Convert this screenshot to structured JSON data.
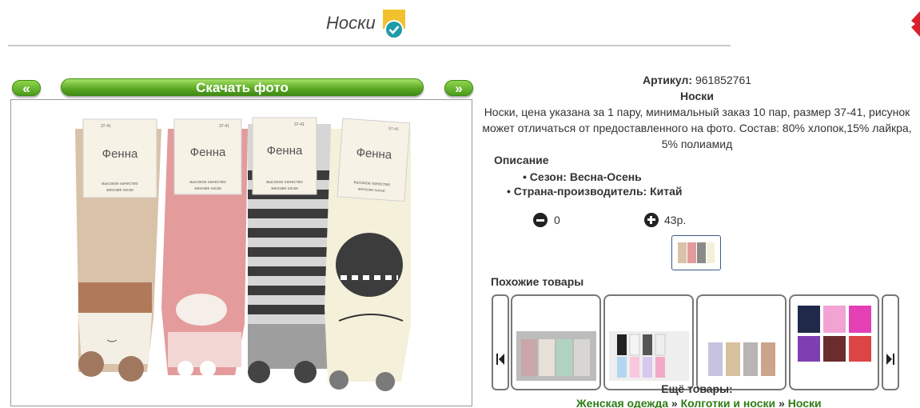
{
  "header": {
    "title": "Носки"
  },
  "gallery": {
    "prev_label": "«",
    "next_label": "»",
    "download_label": "Скачать фото",
    "sock_brand": "Фенна",
    "sock_size": "37-41",
    "sock_caption": "высокое качество",
    "sock_subcaption": "женские носки"
  },
  "product": {
    "article_label": "Артикул:",
    "article_value": "961852761",
    "name": "Носки",
    "description": "Носки, цена указана за 1 пару, минимальный заказ 10 пар, размер 37-41, рисунок может отличаться от предоставленного на фото. Состав: 80% хлопок,15% лайкра, 5% полиамид",
    "description_heading": "Описание",
    "properties": [
      "Сезон: Весна-Осень",
      "Страна-производитель: Китай"
    ],
    "quantity": "0",
    "price": "43р."
  },
  "similar": {
    "title": "Похожие товары"
  },
  "more": {
    "title": "Ещё товары:",
    "breadcrumbs": [
      "Женская одежда",
      "Колготки и носки",
      "Носки"
    ],
    "separator": "»"
  },
  "colors": {
    "accent_green": "#4b9b1c",
    "link_green": "#2e7d16",
    "badge_yellow": "#f2c12e",
    "badge_teal": "#1e9ca8"
  }
}
